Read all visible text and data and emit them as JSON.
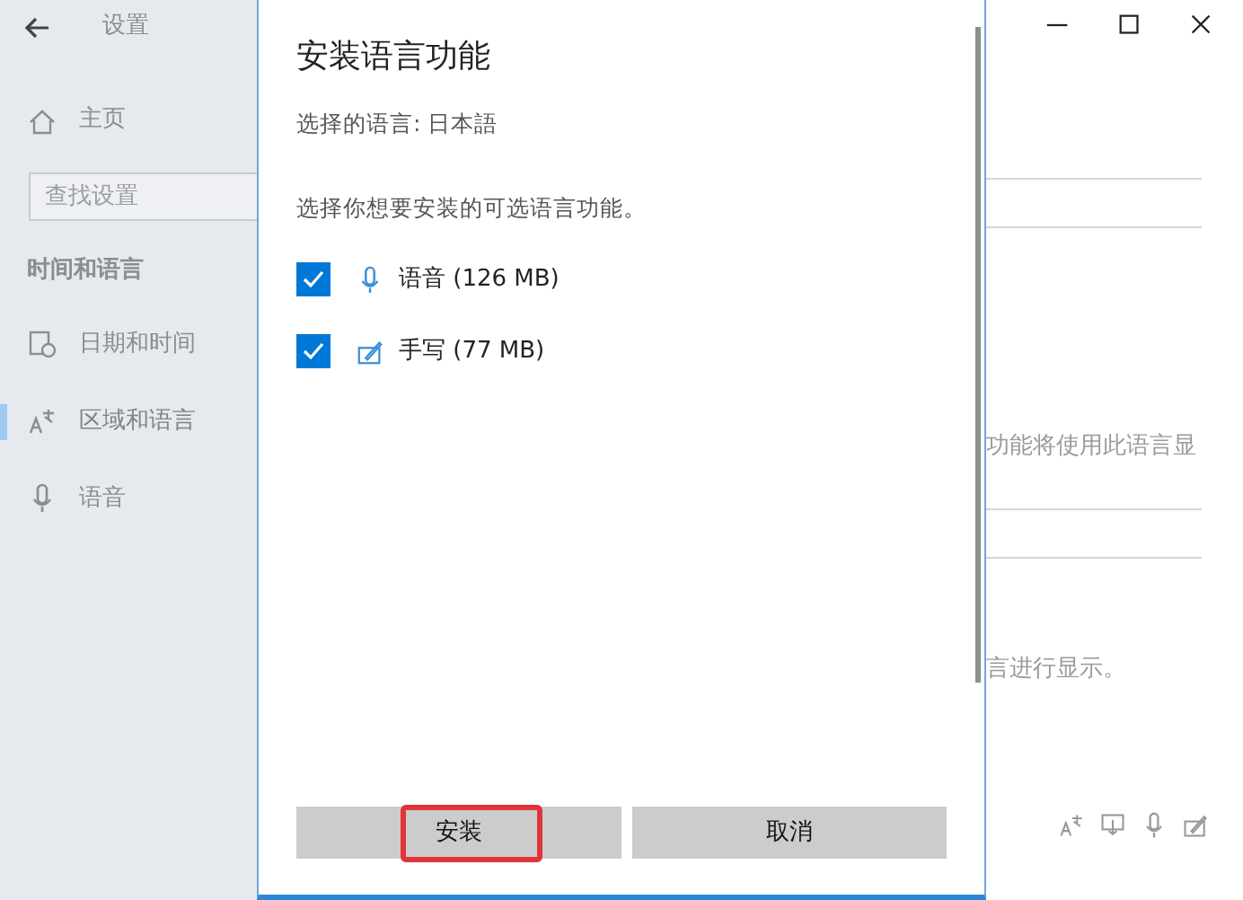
{
  "settings_window": {
    "title": "设置",
    "home": "主页",
    "search": {
      "placeholder": "查找设置"
    },
    "section": "时间和语言",
    "nav_items": [
      {
        "label": "日期和时间",
        "selected": false
      },
      {
        "label": "区域和语言",
        "selected": true
      },
      {
        "label": "语音",
        "selected": false
      }
    ],
    "content_texts": [
      "功能将使用此语言显",
      "言进行显示。"
    ]
  },
  "dialog": {
    "title": "安装语言功能",
    "selected_language": "选择的语言: 日本語",
    "prompt": "选择你想要安装的可选语言功能。",
    "features": [
      {
        "label": "语音 (126 MB)",
        "checked": true
      },
      {
        "label": "手写 (77 MB)",
        "checked": true
      }
    ],
    "buttons": [
      {
        "label": "安装",
        "highlighted": true
      },
      {
        "label": "取消",
        "highlighted": false
      }
    ]
  }
}
